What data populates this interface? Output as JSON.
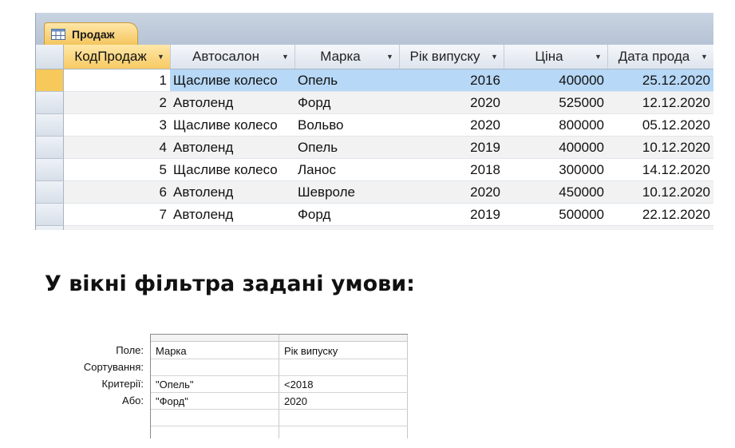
{
  "tab": {
    "title": "Продаж",
    "icon": "table-icon"
  },
  "columns": [
    {
      "label": "КодПродаж"
    },
    {
      "label": "Автосалон"
    },
    {
      "label": "Марка"
    },
    {
      "label": "Рік випуску"
    },
    {
      "label": "Ціна"
    },
    {
      "label": "Дата прода"
    }
  ],
  "rows": [
    {
      "id": "1",
      "salon": "Щасливе колесо",
      "brand": "Опель",
      "year": "2016",
      "price": "400000",
      "date": "25.12.2020"
    },
    {
      "id": "2",
      "salon": "Автоленд",
      "brand": "Форд",
      "year": "2020",
      "price": "525000",
      "date": "12.12.2020"
    },
    {
      "id": "3",
      "salon": "Щасливе колесо",
      "brand": "Вольво",
      "year": "2020",
      "price": "800000",
      "date": "05.12.2020"
    },
    {
      "id": "4",
      "salon": "Автоленд",
      "brand": "Опель",
      "year": "2019",
      "price": "400000",
      "date": "10.12.2020"
    },
    {
      "id": "5",
      "salon": "Щасливе колесо",
      "brand": "Ланос",
      "year": "2018",
      "price": "300000",
      "date": "14.12.2020"
    },
    {
      "id": "6",
      "salon": "Автоленд",
      "brand": "Шевроле",
      "year": "2020",
      "price": "450000",
      "date": "10.12.2020"
    },
    {
      "id": "7",
      "salon": "Автоленд",
      "brand": "Форд",
      "year": "2019",
      "price": "500000",
      "date": "22.12.2020"
    }
  ],
  "question": "У вікні фільтра задані умови:",
  "filter": {
    "row_labels": [
      "Поле:",
      "Сортування:",
      "Критерії:",
      "Або:"
    ],
    "fields": [
      "Марка",
      "Рік випуску"
    ],
    "criteria": [
      "\"Опель\"",
      "<2018"
    ],
    "or": [
      "\"Форд\"",
      "2020"
    ]
  },
  "colors": {
    "accent": "#f7ca63",
    "selection": "#b7d8f6",
    "chrome": "#b6c3d4"
  }
}
